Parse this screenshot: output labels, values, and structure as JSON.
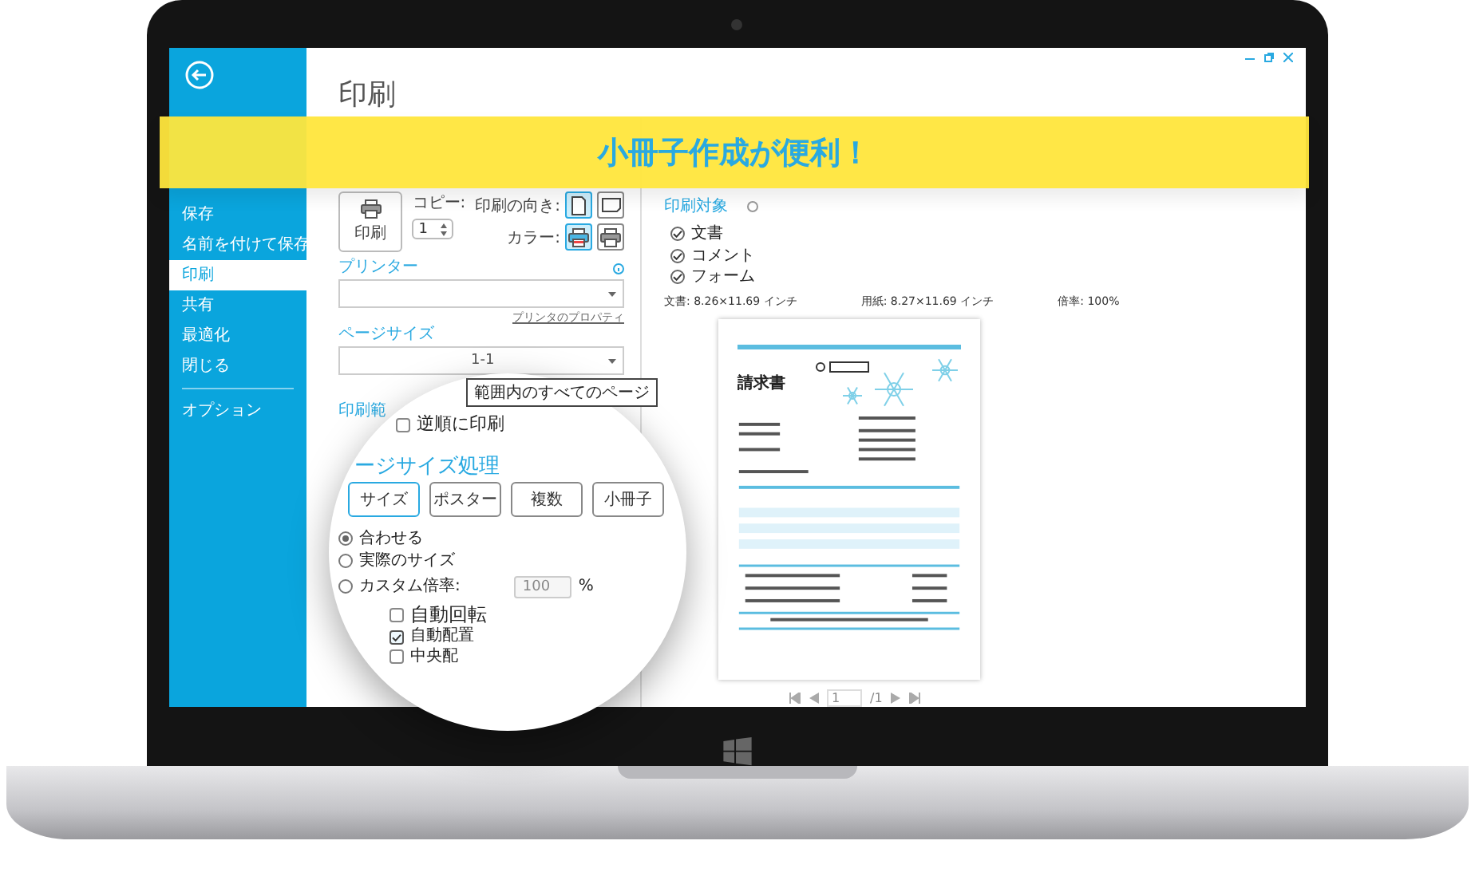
{
  "sidebar": {
    "items": [
      {
        "label": "保存",
        "selected": false
      },
      {
        "label": "名前を付けて保存",
        "selected": false
      },
      {
        "label": "印刷",
        "selected": true
      },
      {
        "label": "共有",
        "selected": false
      },
      {
        "label": "最適化",
        "selected": false
      },
      {
        "label": "閉じる",
        "selected": false
      },
      {
        "label": "オプション",
        "selected": false
      }
    ]
  },
  "banner": {
    "text": "小冊子作成が便利！"
  },
  "print_panel": {
    "title": "印刷",
    "print_button": "印刷",
    "copies_label": "コピー:",
    "copies": "1",
    "orientation_label": "印刷の向き:",
    "orientations": [
      {
        "kind": "portrait",
        "selected": true
      },
      {
        "kind": "landscape",
        "selected": false
      }
    ],
    "color_label": "カラー:",
    "color_modes": [
      {
        "kind": "color",
        "selected": true
      },
      {
        "kind": "grayscale",
        "selected": false
      }
    ],
    "printer_label": "プリンター",
    "printer_properties_link": "プリンタのプロパティ",
    "page_size_label": "ページサイズ",
    "page_range_value": "1-1",
    "page_range_option": "範囲内のすべてのページ",
    "page_range_label": "印刷範"
  },
  "magnifier": {
    "reverse_label": "逆順に印刷",
    "reverse_checked": false,
    "heading": "ージサイズ処理",
    "modes": [
      {
        "label": "サイズ",
        "selected": true
      },
      {
        "label": "ポスター",
        "selected": false
      },
      {
        "label": "複数",
        "selected": false
      },
      {
        "label": "小冊子",
        "selected": false
      }
    ],
    "scaling": [
      {
        "label": "合わせる",
        "selected": true
      },
      {
        "label": "実際のサイズ",
        "selected": false
      },
      {
        "label": "カスタム倍率:",
        "selected": false
      }
    ],
    "custom_scale": "100",
    "percent": "%",
    "options": [
      {
        "label": "自動回転",
        "checked": false
      },
      {
        "label": "自動配置",
        "checked": true
      },
      {
        "label": "中央配",
        "checked": false
      }
    ]
  },
  "preview": {
    "target_label": "印刷対象",
    "targets": [
      {
        "label": "文書",
        "checked": true
      },
      {
        "label": "コメント",
        "checked": true
      },
      {
        "label": "フォーム",
        "checked": true
      }
    ],
    "document_size": "文書:  8.26×11.69  インチ",
    "paper_size": "用紙:  8.27×11.69  インチ",
    "scale": "倍率:  100%",
    "document_title": "請求書",
    "page": "1",
    "page_count": "/1"
  }
}
